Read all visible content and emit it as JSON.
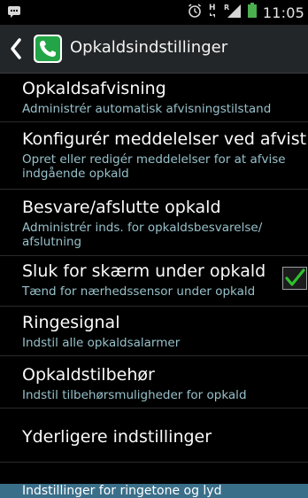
{
  "status_bar": {
    "time": "11:05",
    "icons": [
      "chat-notification-icon",
      "alarm-icon",
      "hsdpa-icon",
      "signal-icon",
      "battery-icon"
    ]
  },
  "action_bar": {
    "title": "Opkaldsindstillinger"
  },
  "settings": [
    {
      "title": "Opkaldsafvisning",
      "subtitle": "Administrér automatisk afvisningstilstand"
    },
    {
      "title": "Konfigurér meddelelser ved afvist..",
      "subtitle": "Opret eller redigér meddelelser for at afvise indgående opkald"
    },
    {
      "title": "Besvare/afslutte opkald",
      "subtitle": "Administrér inds. for opkaldsbesvarelse/ afslutning"
    },
    {
      "title": "Sluk for skærm under opkald",
      "subtitle": "Tænd for nærhedssensor under opkald",
      "checked": true
    },
    {
      "title": "Ringesignal",
      "subtitle": "Indstil alle opkaldsalarmer"
    },
    {
      "title": "Opkaldstilbehør",
      "subtitle": "Indstil tilbehørsmuligheder for opkald"
    },
    {
      "title": "Yderligere indstillinger"
    }
  ],
  "section_header": "Indstillinger for ringetone og lyd",
  "colors": {
    "accent_check": "#2fc02f",
    "subtitle": "#97c1ca",
    "section_bg": "#3a6f8a",
    "app_icon": "#23a446"
  }
}
